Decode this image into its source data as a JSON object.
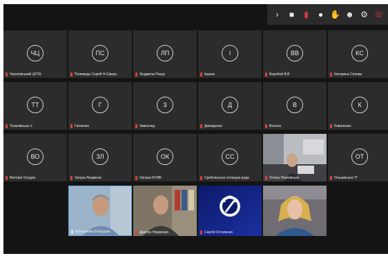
{
  "toolbar": {
    "icons": [
      "chevron-right-icon",
      "video-icon",
      "mic-muted-icon",
      "chat-icon",
      "raise-hand-icon",
      "participants-icon",
      "settings-icon",
      "leave-icon"
    ]
  },
  "tiles": {
    "t1": {
      "initials": "ЧЦ",
      "name": "Чернігівський ЦПТК"
    },
    "t2": {
      "initials": "ПС",
      "name": "Поливода Сергій Н-Сіверс."
    },
    "t3": {
      "initials": "ЛП",
      "name": "Людмила Пекур"
    },
    "t4": {
      "initials": "І",
      "name": "Іванов"
    },
    "t5": {
      "initials": "ВВ",
      "name": "Воробей В.В"
    },
    "t6": {
      "initials": "КС",
      "name": "Катерина Сичова"
    },
    "t7": {
      "initials": "ТТ",
      "name": "Топалівська тг"
    },
    "t8": {
      "initials": "Г",
      "name": "Гапченко"
    },
    "t9": {
      "initials": "З",
      "name": "Зимогляд"
    },
    "t10": {
      "initials": "Д",
      "name": "Демиденко"
    },
    "t11": {
      "initials": "В",
      "name": "Волоха"
    },
    "t12": {
      "initials": "К",
      "name": "Коваленко"
    },
    "t13": {
      "initials": "ВО",
      "name": "Вікторія Осадча"
    },
    "t14": {
      "initials": "ЗЛ",
      "name": "Загура Людмила"
    },
    "t15": {
      "initials": "ОК",
      "name": "Оксана КУЛІК"
    },
    "t16": {
      "initials": "СС",
      "name": "Сребнянська селищна рада"
    },
    "t17": {
      "name": "Олена Пирковська"
    },
    "t18": {
      "initials": "ОТ",
      "name": "Ольшівська ТГ"
    },
    "t19": {
      "name": "Володимир Бобрушко"
    },
    "t20": {
      "name": "Дмитро Науменко"
    },
    "t21": {
      "name": "Сергій Остапенко"
    },
    "t22": {
      "name": ""
    }
  },
  "colors": {
    "screen": "#141414",
    "tile": "#2c2c2c",
    "muted": "#d94242",
    "highlight": "#6aa7e0"
  }
}
